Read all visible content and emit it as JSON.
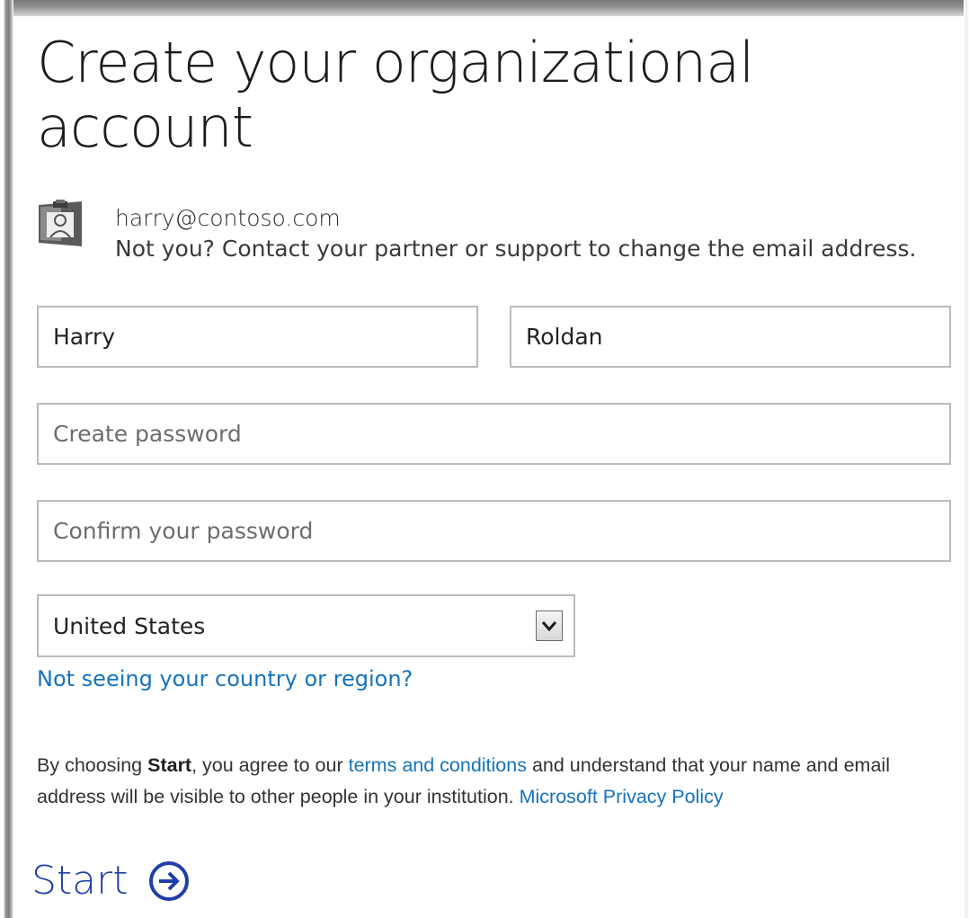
{
  "page": {
    "title": "Create your organizational account"
  },
  "user": {
    "email": "harry@contoso.com",
    "note": "Not you? Contact your partner or support to change the email address.",
    "avatar_icon": "id-badge-icon"
  },
  "form": {
    "first_name_value": "Harry",
    "last_name_value": "Roldan",
    "password_placeholder": "Create password",
    "confirm_placeholder": "Confirm your password",
    "country_selected": "United States",
    "country_dropdown_icon": "chevron-down-icon",
    "region_link": "Not seeing your country or region?"
  },
  "terms": {
    "prefix": "By choosing ",
    "bold": "Start",
    "middle": ", you agree to our ",
    "terms_link": "terms and conditions",
    "suffix": " and understand that your name and email address will be visible to other people in your institution. ",
    "privacy_link": "Microsoft Privacy Policy"
  },
  "actions": {
    "start_label": "Start",
    "start_icon": "arrow-right-circle-icon"
  },
  "colors": {
    "link": "#1573bd",
    "start": "#1f3fa8",
    "border": "#b9bcbe"
  }
}
